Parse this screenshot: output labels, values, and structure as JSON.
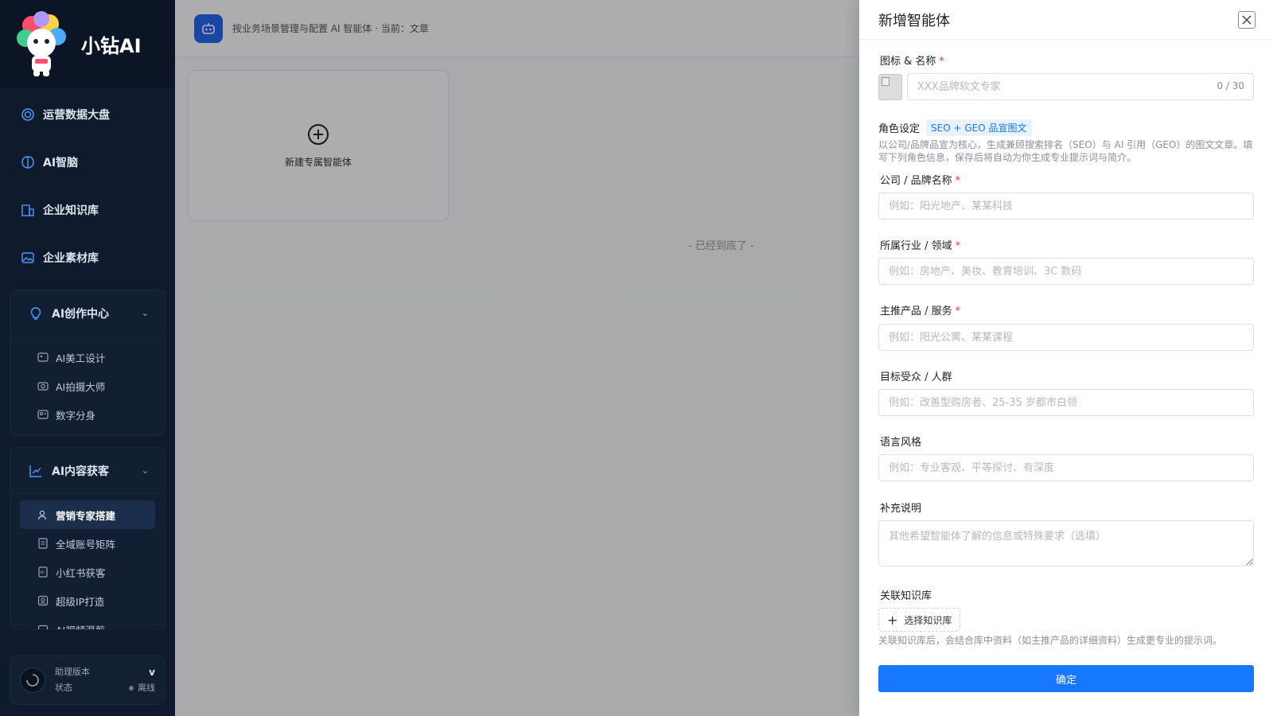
{
  "brand": {
    "name": "小钻AI",
    "logo_text": "小钻AI"
  },
  "sidebar": {
    "top_items": [
      {
        "label": "运营数据大盘",
        "icon": "target-icon"
      },
      {
        "label": "AI智脑",
        "icon": "brain-icon"
      },
      {
        "label": "企业知识库",
        "icon": "building-icon"
      },
      {
        "label": "企业素材库",
        "icon": "image-icon"
      }
    ],
    "group_creation": {
      "title": "AI创作中心",
      "icon": "bulb-icon",
      "items": [
        {
          "label": "AI美工设计",
          "icon": "palette-icon"
        },
        {
          "label": "AI拍摄大师",
          "icon": "camera-icon"
        },
        {
          "label": "数字分身",
          "icon": "avatar-card-icon"
        }
      ]
    },
    "group_content": {
      "title": "AI内容获客",
      "icon": "chart-icon",
      "items": [
        {
          "label": "营销专家搭建",
          "icon": "user-gear-icon",
          "active": true
        },
        {
          "label": "全域账号矩阵",
          "icon": "document-icon"
        },
        {
          "label": "小红书获客",
          "icon": "ai-book-icon"
        },
        {
          "label": "超级IP打造",
          "icon": "badge-icon"
        },
        {
          "label": "AI视频混剪",
          "icon": "video-icon"
        }
      ]
    },
    "footer": {
      "version_label": "助理版本",
      "version_value": "v",
      "status_label": "状态",
      "status_value": "离线"
    }
  },
  "main": {
    "header_text": "按业务场景管理与配置 AI 智能体 · 当前：文章",
    "new_card_label": "新建专属智能体",
    "end_note": "- 已经到底了 -"
  },
  "drawer": {
    "title": "新增智能体",
    "icon_name_label": "图标 & 名称",
    "name_placeholder": "XXX品牌软文专家",
    "name_counter": "0 / 30",
    "role_label": "角色设定",
    "role_tag": "SEO + GEO 品宣图文",
    "role_hint": "以公司/品牌品宣为核心，生成兼顾搜索排名（SEO）与 AI 引用（GEO）的图文文章。填写下列角色信息，保存后将自动为你生成专业提示词与简介。",
    "fields": {
      "company": {
        "label": "公司 / 品牌名称",
        "placeholder": "例如：阳光地产、某某科技"
      },
      "industry": {
        "label": "所属行业 / 领域",
        "placeholder": "例如：房地产、美妆、教育培训、3C 数码"
      },
      "product": {
        "label": "主推产品 / 服务",
        "placeholder": "例如：阳光公寓、某某课程"
      },
      "audience": {
        "label": "目标受众 / 人群",
        "placeholder": "例如：改善型购房者、25-35 岁都市白领"
      },
      "style": {
        "label": "语言风格",
        "placeholder": "例如：专业客观、平等探讨、有深度"
      },
      "extra": {
        "label": "补充说明",
        "placeholder": "其他希望智能体了解的信息或特殊要求（选填）"
      }
    },
    "kb_label": "关联知识库",
    "kb_button": "选择知识库",
    "kb_hint": "关联知识库后，会结合库中资料（如主推产品的详细资料）生成更专业的提示词。",
    "confirm": "确定"
  },
  "colors": {
    "accent": "#1677ff",
    "sidebar_bg": "#0f1a2c",
    "required": "#e53935"
  }
}
